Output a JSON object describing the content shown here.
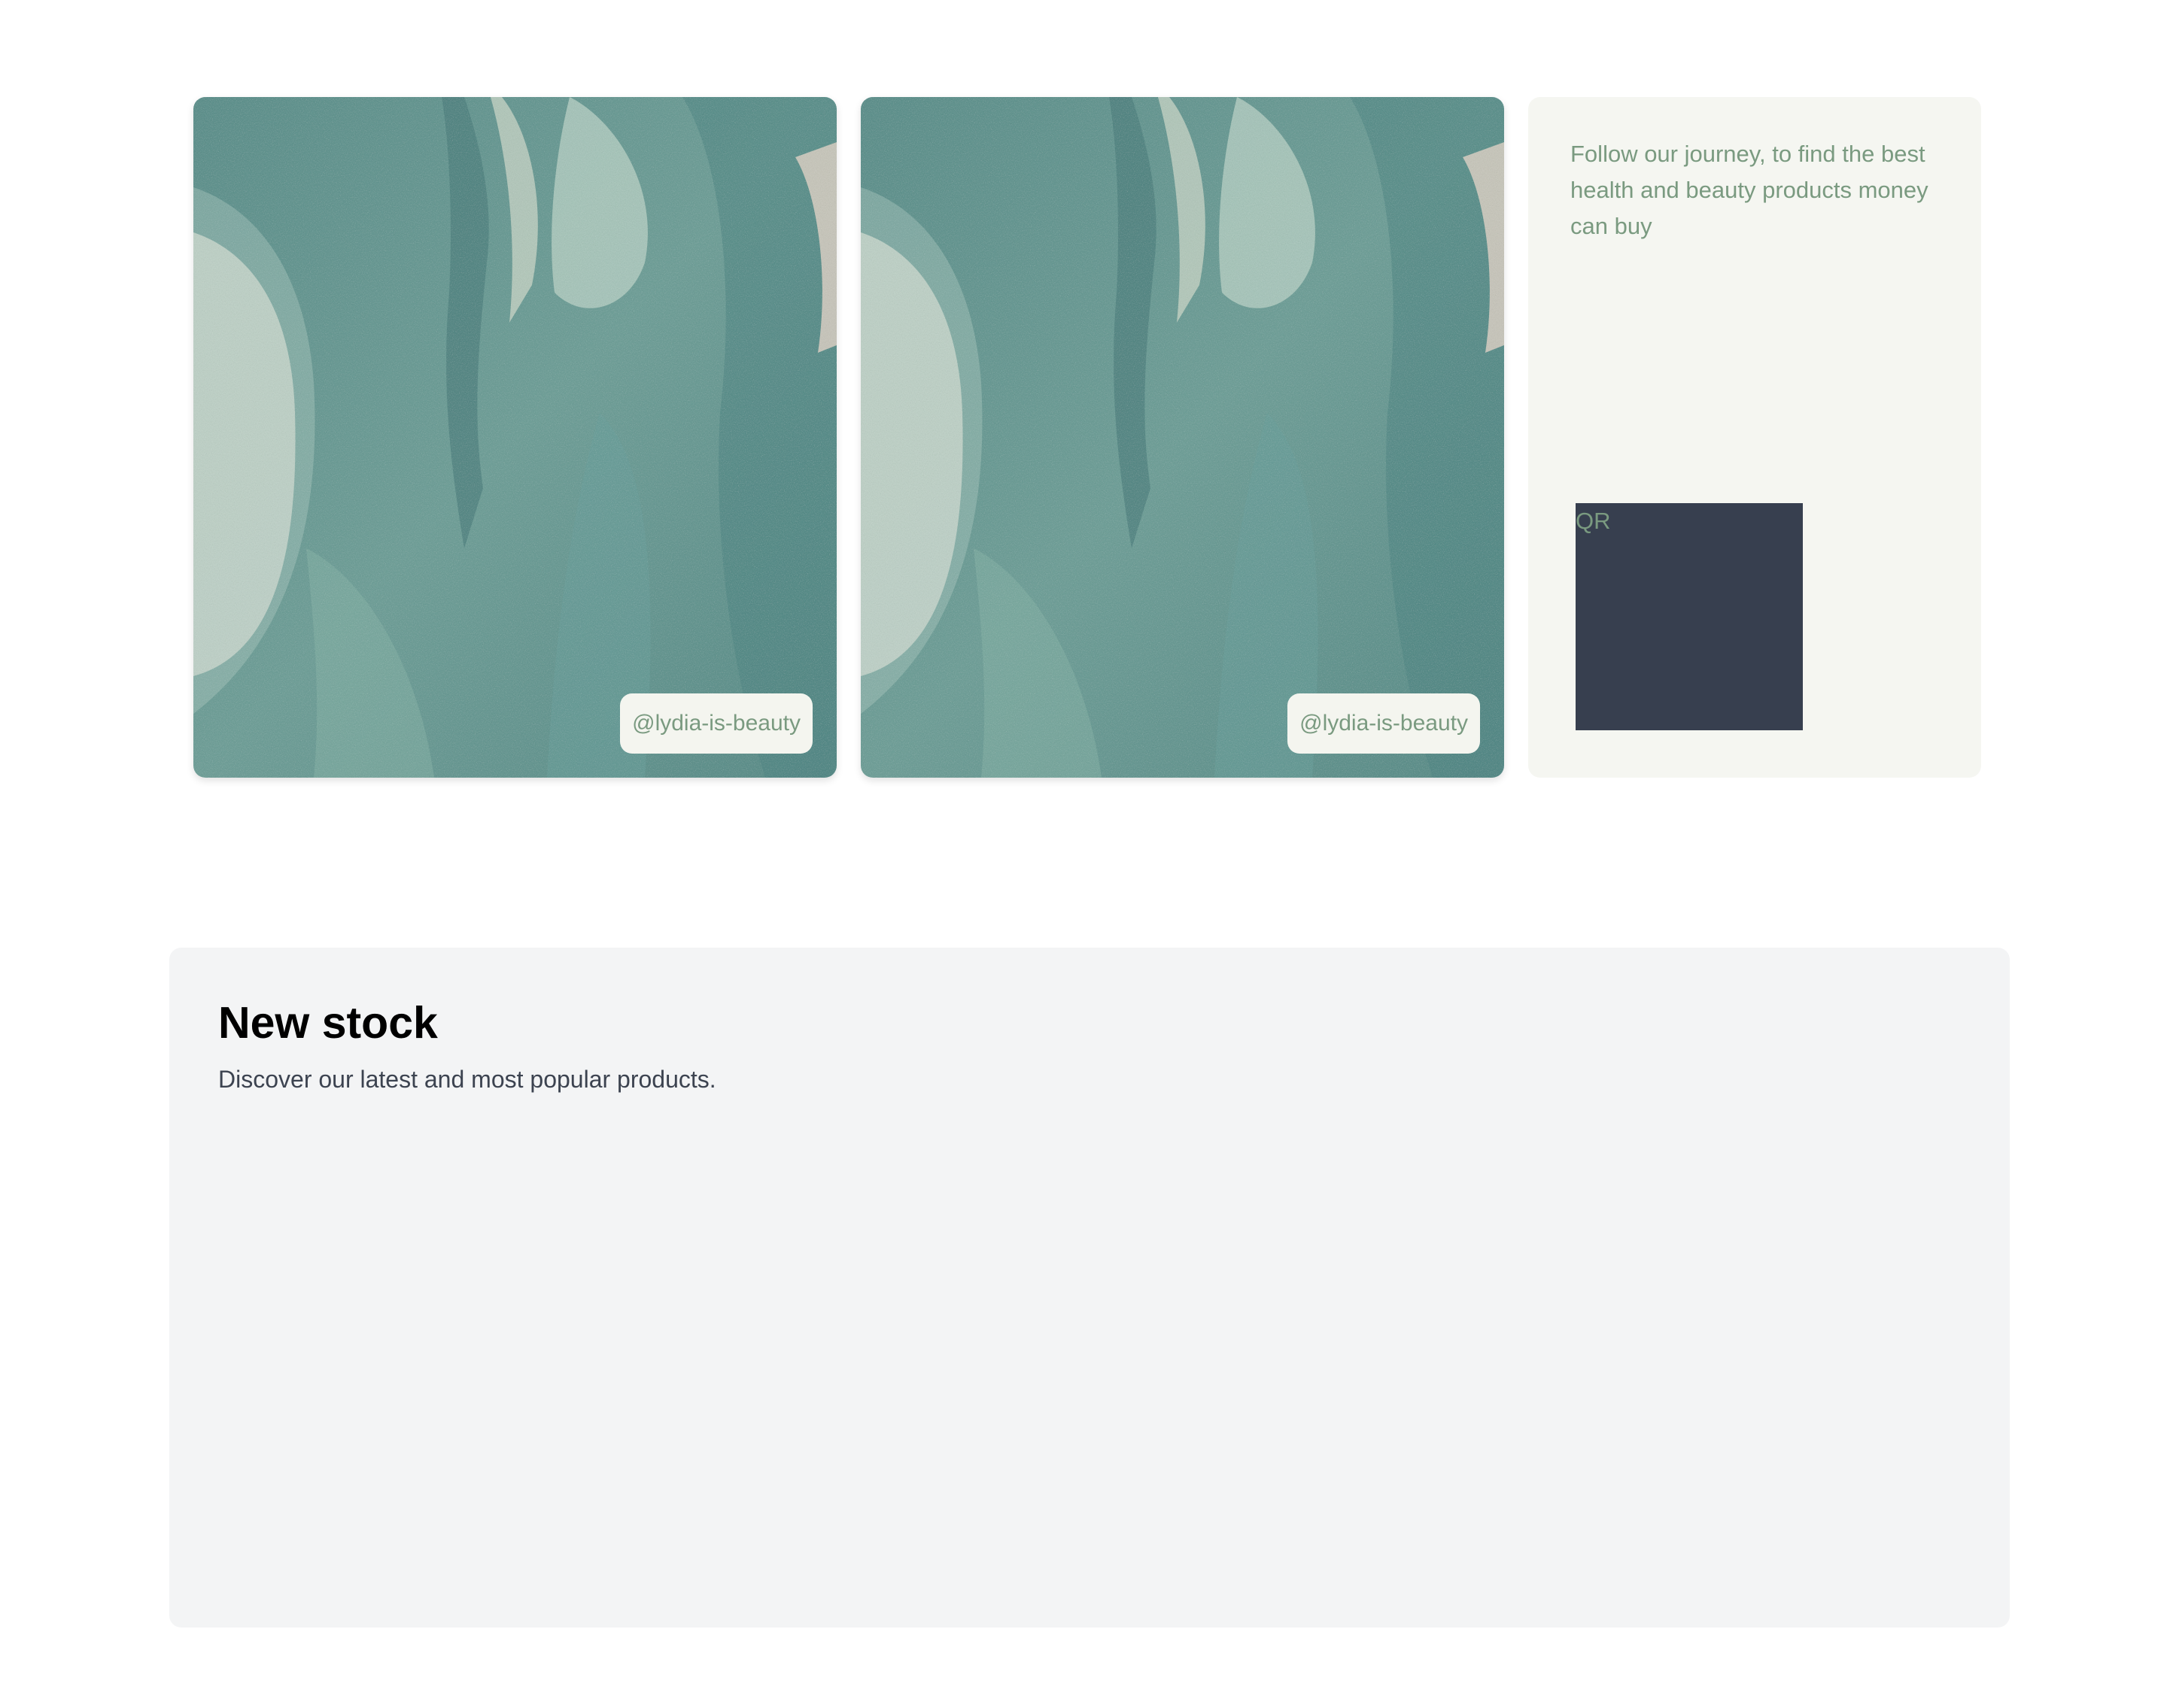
{
  "gallery": {
    "cards": [
      {
        "image": "sage-green-texture-photo",
        "handle": "@lydia-is-beauty"
      },
      {
        "image": "sage-green-texture-photo",
        "handle": "@lydia-is-beauty"
      }
    ],
    "follow": {
      "text": "Follow our journey, to find the best health and beauty products money can buy",
      "qr_label": "QR"
    }
  },
  "new_stock": {
    "title": "New stock",
    "subtitle": "Discover our latest and most popular products."
  },
  "colors": {
    "accent_text": "#7a9a80",
    "badge_bg": "#f4f5ef",
    "follow_bg": "#f5f6f1",
    "qr_bg": "#373f4f",
    "section_bg": "#f3f4f5",
    "texture_base": "#6e9e97"
  }
}
